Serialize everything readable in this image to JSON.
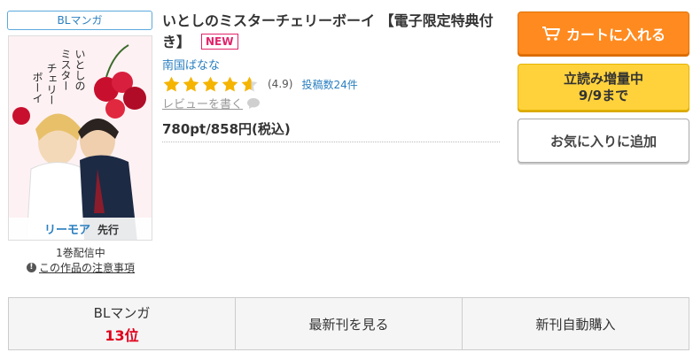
{
  "product": {
    "category": "BLマンガ",
    "title": "いとしのミスターチェリーボーイ 【電子限定特典付き】",
    "new_badge": "NEW",
    "author": "南国ばなな",
    "rating": {
      "value": 4.9,
      "max": 5,
      "text": "(4.9)",
      "review_count": "投稿数24件"
    },
    "write_review": "レビューを書く",
    "price": "780pt/858円(税込)",
    "volume_status": "1巻配信中",
    "notice": "この作品の注意事項"
  },
  "cover": {
    "title_vertical_1": "いとしの",
    "title_vertical_2": "ミスター",
    "title_vertical_3": "チェリー",
    "title_vertical_4": "ボーイ",
    "label_brand": "リーモア",
    "label_preview": "先行"
  },
  "buttons": {
    "cart": "カートに入れる",
    "trial_line1": "立読み増量中",
    "trial_line2": "9/9まで",
    "favorite": "お気に入りに追加"
  },
  "bottom_bar": {
    "ranking_category": "BLマンガ",
    "ranking_position": "13位",
    "latest": "最新刊を見る",
    "auto_purchase": "新刊自動購入"
  },
  "colors": {
    "accent_orange": "#ff8a1f",
    "accent_yellow": "#ffd23c",
    "link_blue": "#2a7fc0",
    "star_gold": "#f5b400",
    "rank_red": "#e0001b"
  }
}
